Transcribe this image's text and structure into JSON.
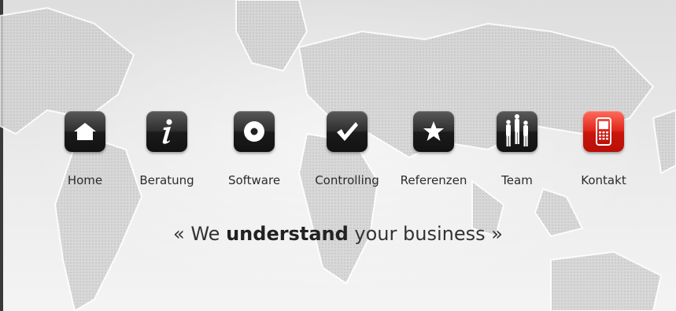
{
  "nav": {
    "items": [
      {
        "label": "Home",
        "icon": "home-icon"
      },
      {
        "label": "Beratung",
        "icon": "info-icon"
      },
      {
        "label": "Software",
        "icon": "disc-icon"
      },
      {
        "label": "Controlling",
        "icon": "checkmark-icon"
      },
      {
        "label": "Referenzen",
        "icon": "star-icon"
      },
      {
        "label": "Team",
        "icon": "team-icon"
      },
      {
        "label": "Kontakt",
        "icon": "mobile-phone-icon"
      }
    ]
  },
  "tagline": {
    "open_quote": "«",
    "before": "We",
    "emphasis": "understand",
    "after": "your business",
    "close_quote": "»"
  },
  "colors": {
    "tile_dark": "#1b1b1b",
    "tile_red": "#d0201a",
    "text": "#2b2b2b"
  }
}
